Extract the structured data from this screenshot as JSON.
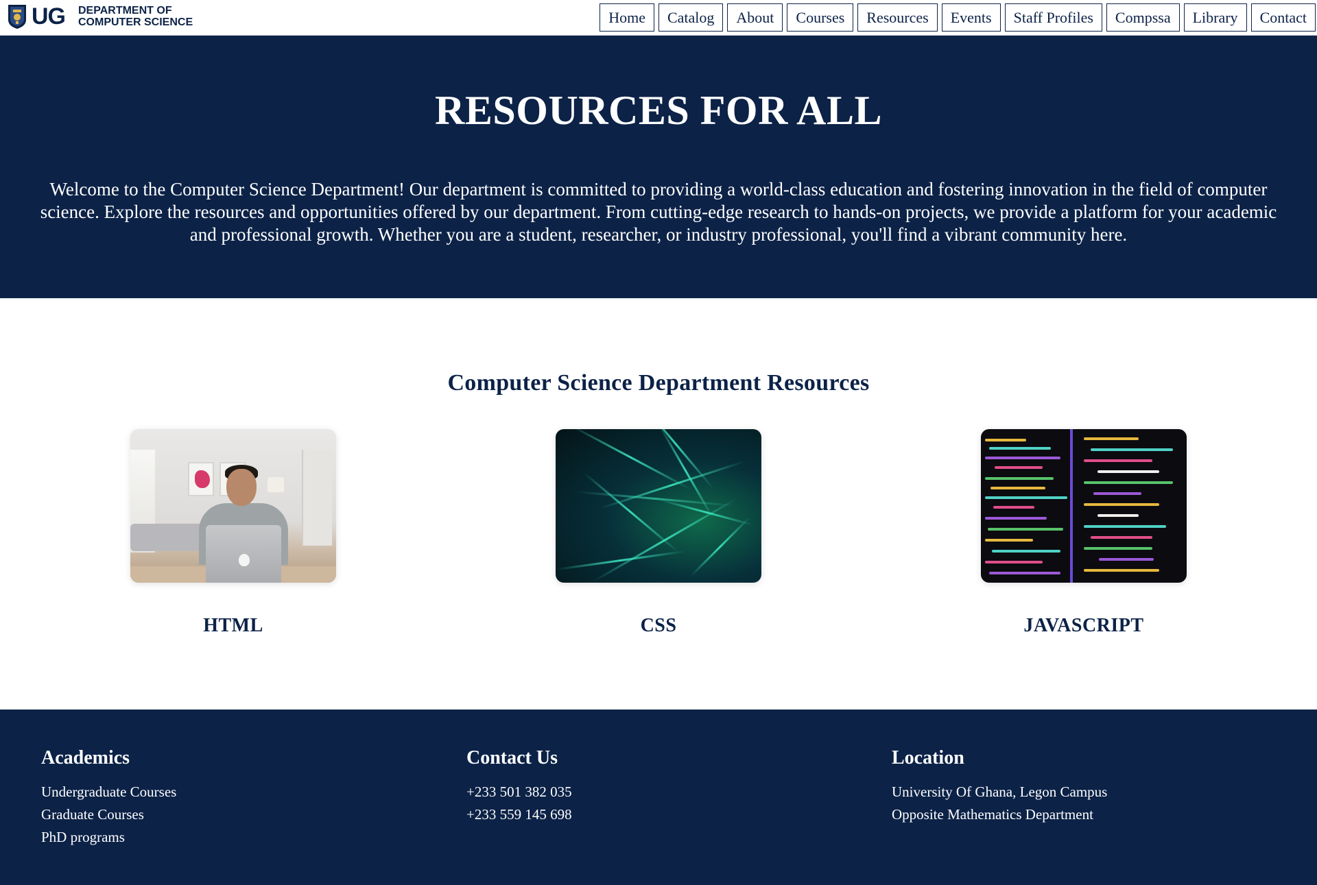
{
  "header": {
    "logo_mark": "UG",
    "department_line1": "DEPARTMENT OF",
    "department_line2": "COMPUTER SCIENCE",
    "nav": [
      "Home",
      "Catalog",
      "About",
      "Courses",
      "Resources",
      "Events",
      "Staff Profiles",
      "Compssa",
      "Library",
      "Contact"
    ]
  },
  "hero": {
    "title": "RESOURCES FOR ALL",
    "intro": "Welcome to the Computer Science Department! Our department is committed to providing a world-class education and fostering innovation in the field of computer science. Explore the resources and opportunities offered by our department. From cutting-edge research to hands-on projects, we provide a platform for your academic and professional growth. Whether you are a student, researcher, or industry professional, you'll find a vibrant community here."
  },
  "resources": {
    "title": "Computer Science Department Resources",
    "cards": [
      {
        "label": "HTML",
        "image": "person-laptop-photo"
      },
      {
        "label": "CSS",
        "image": "light-streaks-photo"
      },
      {
        "label": "JAVASCRIPT",
        "image": "code-screen-photo"
      }
    ]
  },
  "footer": {
    "academics": {
      "title": "Academics",
      "items": [
        "Undergraduate Courses",
        "Graduate Courses",
        "PhD programs"
      ]
    },
    "contact": {
      "title": "Contact Us",
      "items": [
        "+233 501 382 035",
        "+233 559 145 698"
      ]
    },
    "location": {
      "title": "Location",
      "items": [
        "University Of Ghana, Legon Campus",
        "Opposite Mathematics Department"
      ]
    }
  },
  "colors": {
    "navy": "#0c2247",
    "white": "#ffffff"
  }
}
